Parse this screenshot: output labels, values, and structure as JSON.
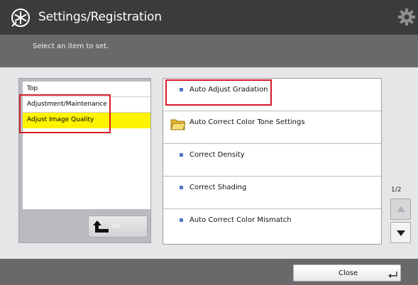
{
  "header": {
    "title": "Settings/Registration",
    "title_icon": "settings-registration-icon",
    "gear_icon": "gear-icon"
  },
  "instruction": "Select an item to set.",
  "tree": {
    "items": [
      {
        "label": "Top",
        "selected": false
      },
      {
        "label": "Adjustment/Maintenance",
        "selected": false
      },
      {
        "label": "Adjust Image Quality",
        "selected": true
      }
    ],
    "up_label": "Up",
    "up_icon": "up-arrow-icon"
  },
  "list": {
    "items": [
      {
        "label": "Auto Adjust Gradation",
        "kind": "item"
      },
      {
        "label": "Auto Correct Color Tone Settings",
        "kind": "folder"
      },
      {
        "label": "Correct Density",
        "kind": "item"
      },
      {
        "label": "Correct Shading",
        "kind": "item"
      },
      {
        "label": "Auto Correct Color Mismatch",
        "kind": "item"
      }
    ]
  },
  "pagination": {
    "indicator": "1/2"
  },
  "footer": {
    "close_label": "Close",
    "close_icon": "enter-icon"
  },
  "colors": {
    "title_bar": "#3b3b3d",
    "sub_bar": "#69696b",
    "selection": "#fff300",
    "highlight": "#d51a27",
    "bullet": "#4d77c4"
  }
}
